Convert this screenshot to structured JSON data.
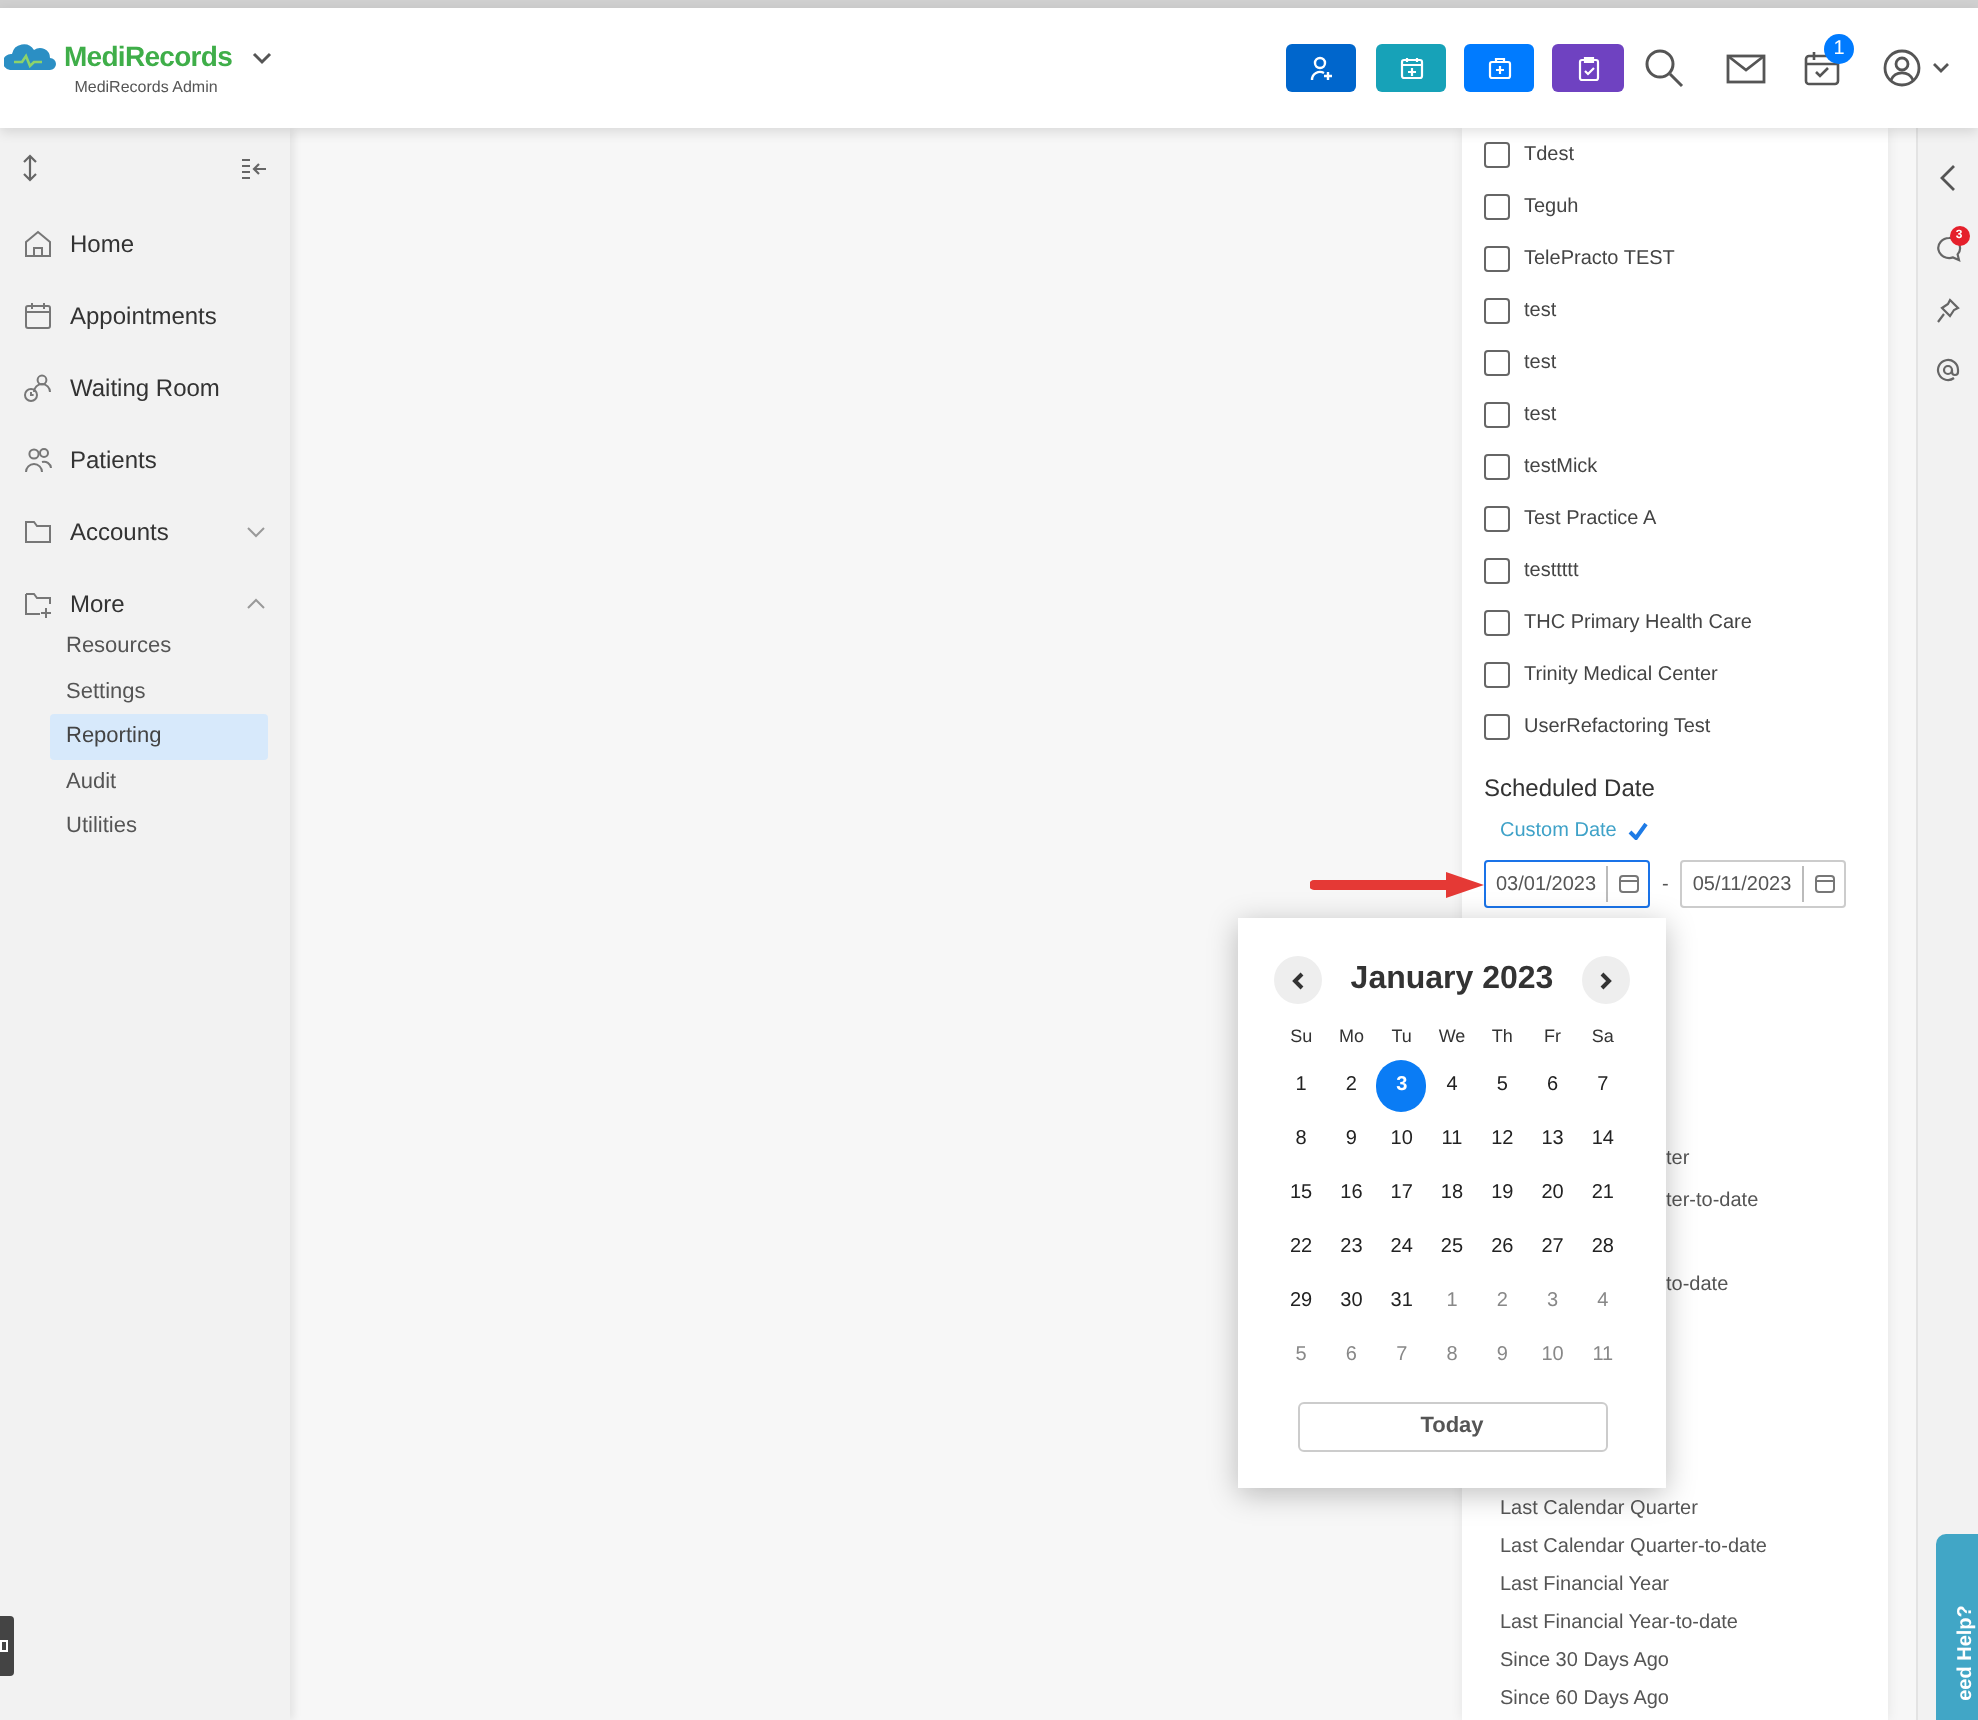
{
  "header": {
    "brand": "MediRecords",
    "subtitle": "MediRecords Admin",
    "notification_count": "1"
  },
  "sidebar": {
    "items": [
      {
        "label": "Home",
        "kind": "link"
      },
      {
        "label": "Appointments",
        "kind": "link"
      },
      {
        "label": "Waiting Room",
        "kind": "link"
      },
      {
        "label": "Patients",
        "kind": "link"
      },
      {
        "label": "Accounts",
        "kind": "group",
        "expanded": false
      },
      {
        "label": "More",
        "kind": "group",
        "expanded": true,
        "children": [
          {
            "label": "Resources",
            "selected": false
          },
          {
            "label": "Settings",
            "selected": false
          },
          {
            "label": "Reporting",
            "selected": true
          },
          {
            "label": "Audit",
            "selected": false
          },
          {
            "label": "Utilities",
            "selected": false
          }
        ]
      }
    ]
  },
  "filter_panel": {
    "practices": [
      {
        "label": "Tdest",
        "checked": false
      },
      {
        "label": "Teguh",
        "checked": false
      },
      {
        "label": "TelePracto TEST",
        "checked": false
      },
      {
        "label": "test",
        "checked": false
      },
      {
        "label": "test",
        "checked": false
      },
      {
        "label": "test",
        "checked": false
      },
      {
        "label": "testMick",
        "checked": false
      },
      {
        "label": "Test Practice A",
        "checked": false
      },
      {
        "label": "testtttt",
        "checked": false
      },
      {
        "label": "THC Primary Health Care",
        "checked": false
      },
      {
        "label": "Trinity Medical Center",
        "checked": false
      },
      {
        "label": "UserRefactoring Test",
        "checked": false
      }
    ],
    "section_title": "Scheduled Date",
    "custom_date": {
      "label": "Custom Date",
      "checked": true
    },
    "from_date": "03/01/2023",
    "to_date": "05/11/2023",
    "separator": "-",
    "presets_behind_popup": [
      "ter",
      "ter-to-date",
      "to-date"
    ],
    "presets": [
      "Last Calendar Quarter",
      "Last Calendar Quarter-to-date",
      "Last Financial Year",
      "Last Financial Year-to-date",
      "Since 30 Days Ago",
      "Since 60 Days Ago"
    ]
  },
  "date_picker": {
    "title": "January 2023",
    "weekdays": [
      "Su",
      "Mo",
      "Tu",
      "We",
      "Th",
      "Fr",
      "Sa"
    ],
    "days": [
      {
        "label": "1",
        "kind": "current",
        "selected": false
      },
      {
        "label": "2",
        "kind": "current",
        "selected": false
      },
      {
        "label": "3",
        "kind": "current",
        "selected": true
      },
      {
        "label": "4",
        "kind": "current",
        "selected": false
      },
      {
        "label": "5",
        "kind": "current",
        "selected": false
      },
      {
        "label": "6",
        "kind": "current",
        "selected": false
      },
      {
        "label": "7",
        "kind": "current",
        "selected": false
      },
      {
        "label": "8",
        "kind": "current",
        "selected": false
      },
      {
        "label": "9",
        "kind": "current",
        "selected": false
      },
      {
        "label": "10",
        "kind": "current",
        "selected": false
      },
      {
        "label": "11",
        "kind": "current",
        "selected": false
      },
      {
        "label": "12",
        "kind": "current",
        "selected": false
      },
      {
        "label": "13",
        "kind": "current",
        "selected": false
      },
      {
        "label": "14",
        "kind": "current",
        "selected": false
      },
      {
        "label": "15",
        "kind": "current",
        "selected": false
      },
      {
        "label": "16",
        "kind": "current",
        "selected": false
      },
      {
        "label": "17",
        "kind": "current",
        "selected": false
      },
      {
        "label": "18",
        "kind": "current",
        "selected": false
      },
      {
        "label": "19",
        "kind": "current",
        "selected": false
      },
      {
        "label": "20",
        "kind": "current",
        "selected": false
      },
      {
        "label": "21",
        "kind": "current",
        "selected": false
      },
      {
        "label": "22",
        "kind": "current",
        "selected": false
      },
      {
        "label": "23",
        "kind": "current",
        "selected": false
      },
      {
        "label": "24",
        "kind": "current",
        "selected": false
      },
      {
        "label": "25",
        "kind": "current",
        "selected": false
      },
      {
        "label": "26",
        "kind": "current",
        "selected": false
      },
      {
        "label": "27",
        "kind": "current",
        "selected": false
      },
      {
        "label": "28",
        "kind": "current",
        "selected": false
      },
      {
        "label": "29",
        "kind": "current",
        "selected": false
      },
      {
        "label": "30",
        "kind": "current",
        "selected": false
      },
      {
        "label": "31",
        "kind": "current",
        "selected": false
      },
      {
        "label": "1",
        "kind": "other",
        "selected": false
      },
      {
        "label": "2",
        "kind": "other",
        "selected": false
      },
      {
        "label": "3",
        "kind": "other",
        "selected": false
      },
      {
        "label": "4",
        "kind": "other",
        "selected": false
      },
      {
        "label": "5",
        "kind": "other",
        "selected": false
      },
      {
        "label": "6",
        "kind": "other",
        "selected": false
      },
      {
        "label": "7",
        "kind": "other",
        "selected": false
      },
      {
        "label": "8",
        "kind": "other",
        "selected": false
      },
      {
        "label": "9",
        "kind": "other",
        "selected": false
      },
      {
        "label": "10",
        "kind": "other",
        "selected": false
      },
      {
        "label": "11",
        "kind": "other",
        "selected": false
      }
    ],
    "today_button": "Today"
  },
  "right_rail": {
    "comments_count": "3"
  },
  "help_tab": "eed Help?"
}
